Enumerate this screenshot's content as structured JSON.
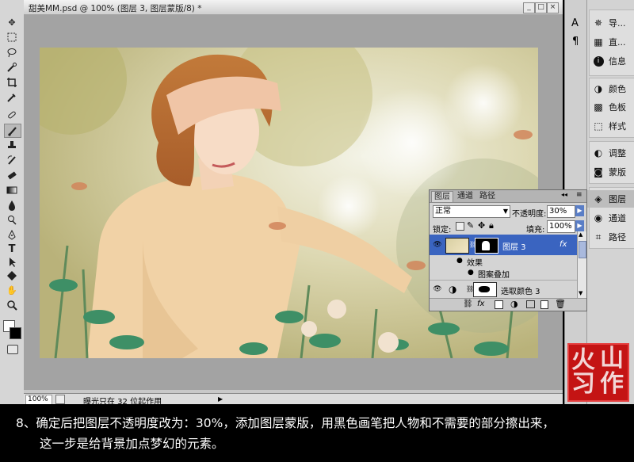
{
  "document": {
    "title": "甜美MM.psd @ 100% (图层 3, 图层蒙版/8) *",
    "zoom": "100%",
    "status": "曝光只在 32 位起作用",
    "win_buttons": [
      "_",
      "□",
      "×"
    ]
  },
  "dock": {
    "items": [
      {
        "label": "导...",
        "icon": "navigator-icon"
      },
      {
        "label": "直...",
        "icon": "histogram-icon"
      },
      {
        "label": "信息",
        "icon": "info-icon"
      },
      {
        "label": "颜色",
        "icon": "color-icon"
      },
      {
        "label": "色板",
        "icon": "swatches-icon"
      },
      {
        "label": "样式",
        "icon": "styles-icon"
      },
      {
        "label": "调整",
        "icon": "adjustments-icon"
      },
      {
        "label": "蒙版",
        "icon": "masks-icon"
      },
      {
        "label": "图层",
        "icon": "layers-icon"
      },
      {
        "label": "通道",
        "icon": "channels-icon"
      },
      {
        "label": "路径",
        "icon": "paths-icon"
      }
    ],
    "side_icons": [
      "A",
      "¶"
    ]
  },
  "layers_panel": {
    "tabs": [
      "图层",
      "通道",
      "路径"
    ],
    "blend_mode": "正常",
    "opacity_label": "不透明度:",
    "opacity_value": "30%",
    "lock_label": "锁定:",
    "fill_label": "填充:",
    "fill_value": "100%",
    "layers": [
      {
        "name": "图层 3",
        "selected": true,
        "fx": "fx"
      },
      {
        "name": "效果",
        "type": "effects-group"
      },
      {
        "name": "图案叠加",
        "type": "effect"
      },
      {
        "name": "选取颜色 3",
        "selected": false
      }
    ]
  },
  "seal": {
    "chars": [
      "山",
      "火",
      "作",
      "习"
    ]
  },
  "caption": {
    "line1": "8、确定后把图层不透明度改为：30%，添加图层蒙版，用黑色画笔把人物和不需要的部分擦出来，",
    "line2": "这一步是给背景加点梦幻的元素。"
  },
  "colors": {
    "selected_row": "#3a64c0",
    "seal_red": "#c41414"
  }
}
